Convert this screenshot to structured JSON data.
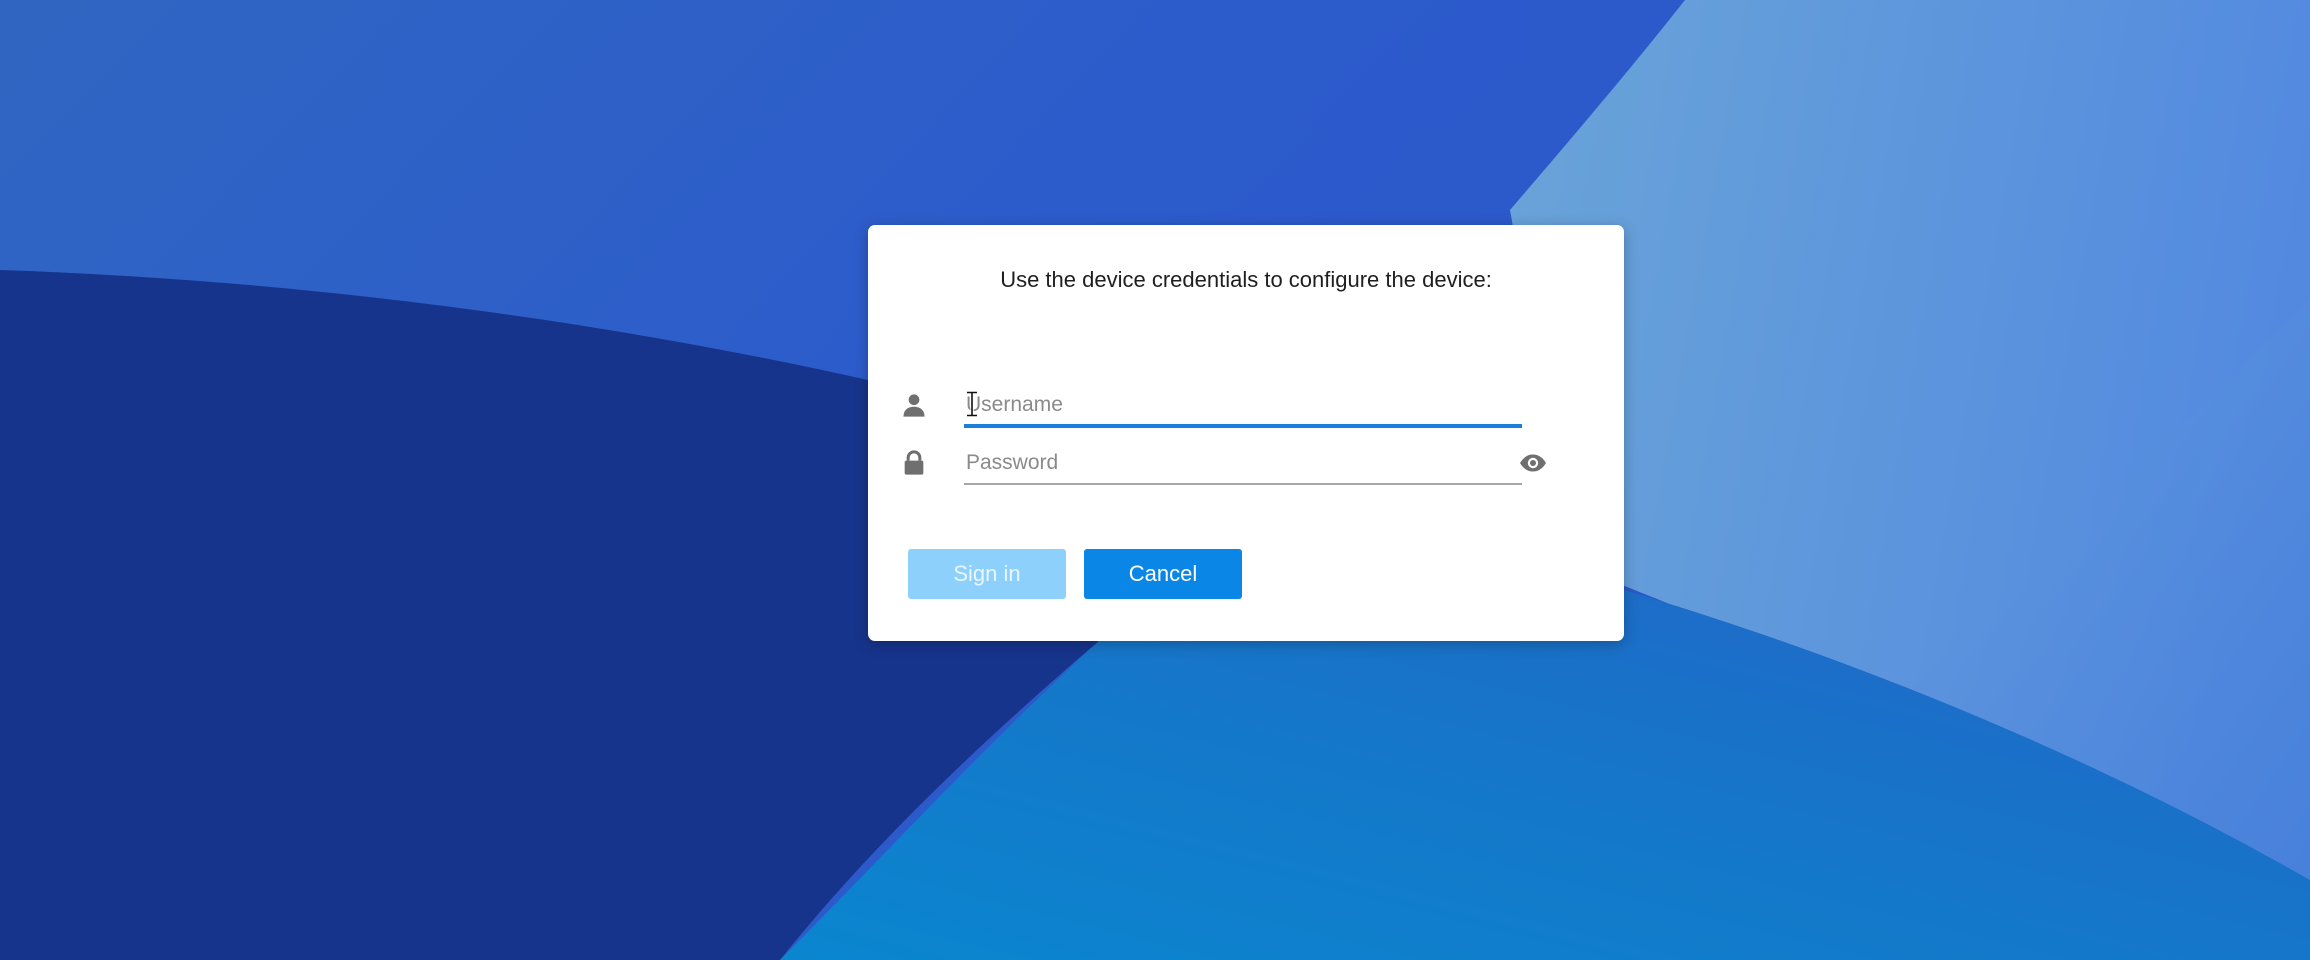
{
  "dialog": {
    "title": "Use the device credentials to configure the device:"
  },
  "username": {
    "placeholder": "Username",
    "value": "",
    "icon": "user-icon",
    "focused": true
  },
  "password": {
    "placeholder": "Password",
    "value": "",
    "icon": "lock-icon",
    "toggle_icon": "eye-icon"
  },
  "buttons": {
    "signin_label": "Sign in",
    "cancel_label": "Cancel"
  },
  "colors": {
    "accent": "#0a86e6",
    "accent_disabled": "#8dd0fb",
    "focus_underline": "#1a7fd8",
    "background_dark": "#17348c",
    "background_mid": "#2d5ac8",
    "background_light": "#5f98dc"
  }
}
